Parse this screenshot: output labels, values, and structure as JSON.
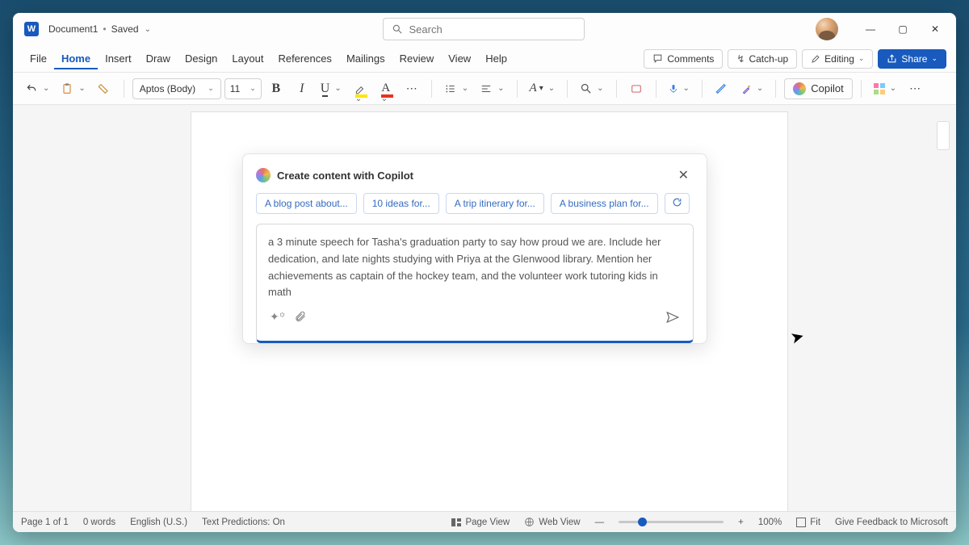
{
  "titlebar": {
    "doc_name": "Document1",
    "save_state": "Saved",
    "search_placeholder": "Search"
  },
  "menu": {
    "items": [
      "File",
      "Home",
      "Insert",
      "Draw",
      "Design",
      "Layout",
      "References",
      "Mailings",
      "Review",
      "View",
      "Help"
    ],
    "active_index": 1,
    "comments": "Comments",
    "catchup": "Catch-up",
    "editing": "Editing",
    "share": "Share"
  },
  "ribbon": {
    "font_name": "Aptos (Body)",
    "font_size": "11",
    "copilot_label": "Copilot"
  },
  "copilot": {
    "title": "Create content with Copilot",
    "chips": [
      "A blog post about...",
      "10 ideas for...",
      "A trip itinerary for...",
      "A business plan for..."
    ],
    "prompt": "a 3 minute speech for Tasha's graduation party to say how proud we are. Include her dedication, and late nights studying with Priya at the Glenwood library. Mention her achievements as captain of the hockey team, and the volunteer work tutoring kids in math"
  },
  "statusbar": {
    "page": "Page 1 of 1",
    "words": "0 words",
    "lang": "English (U.S.)",
    "predictions": "Text Predictions: On",
    "page_view": "Page View",
    "web_view": "Web View",
    "zoom": "100%",
    "fit": "Fit",
    "feedback": "Give Feedback to Microsoft"
  }
}
